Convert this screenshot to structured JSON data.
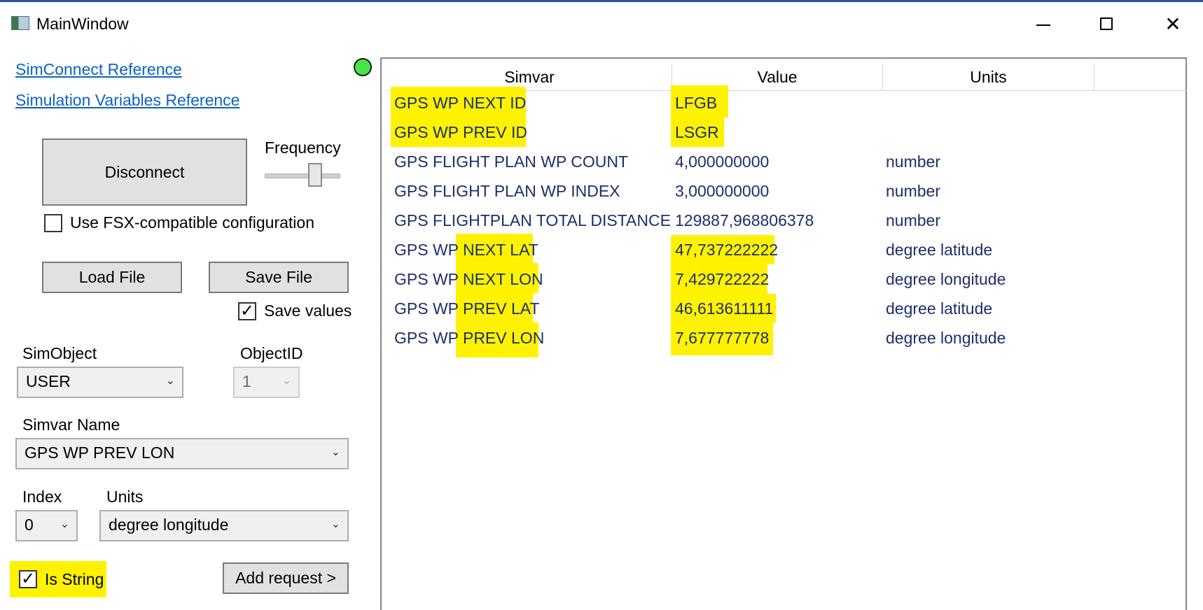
{
  "window": {
    "title": "MainWindow",
    "minimize": "—",
    "maximize": "☐",
    "close": "✕"
  },
  "links": {
    "simconnect": "SimConnect Reference",
    "simvars": "Simulation Variables Reference"
  },
  "status": {
    "connected_color": "#47e447"
  },
  "controls": {
    "disconnect_label": "Disconnect",
    "frequency_label": "Frequency",
    "frequency_level": 0.7,
    "fsx_checkbox_label": "Use FSX-compatible configuration",
    "fsx_checked": false,
    "load_file_label": "Load File",
    "save_file_label": "Save File",
    "save_values_label": "Save values",
    "save_values_checked": true,
    "simobject_label": "SimObject",
    "simobject_value": "USER",
    "objectid_label": "ObjectID",
    "objectid_value": "1",
    "simvar_name_label": "Simvar Name",
    "simvar_name_value": "GPS WP PREV LON",
    "index_label": "Index",
    "index_value": "0",
    "units_label": "Units",
    "units_value": "degree longitude",
    "is_string_label": "Is String",
    "is_string_checked": true,
    "add_request_label": "Add request >",
    "check_mark": "✓",
    "dropdown_arrow": "⌄"
  },
  "grid": {
    "headers": [
      "Simvar",
      "Value",
      "Units"
    ],
    "rows": [
      {
        "simvar": "GPS WP NEXT ID",
        "value": "LFGB",
        "units": ""
      },
      {
        "simvar": "GPS WP PREV ID",
        "value": "LSGR",
        "units": ""
      },
      {
        "simvar": "GPS FLIGHT PLAN WP COUNT",
        "value": "4,000000000",
        "units": "number"
      },
      {
        "simvar": "GPS FLIGHT PLAN WP INDEX",
        "value": "3,000000000",
        "units": "number"
      },
      {
        "simvar": "GPS FLIGHTPLAN TOTAL DISTANCE",
        "value": "129887,968806378",
        "units": "number"
      },
      {
        "simvar": "GPS WP NEXT LAT",
        "value": "47,737222222",
        "units": "degree latitude"
      },
      {
        "simvar": "GPS WP NEXT LON",
        "value": "7,429722222",
        "units": "degree longitude"
      },
      {
        "simvar": "GPS WP PREV LAT",
        "value": "46,613611111",
        "units": "degree latitude"
      },
      {
        "simvar": "GPS WP PREV LON",
        "value": "7,677777778",
        "units": "degree longitude"
      }
    ]
  }
}
